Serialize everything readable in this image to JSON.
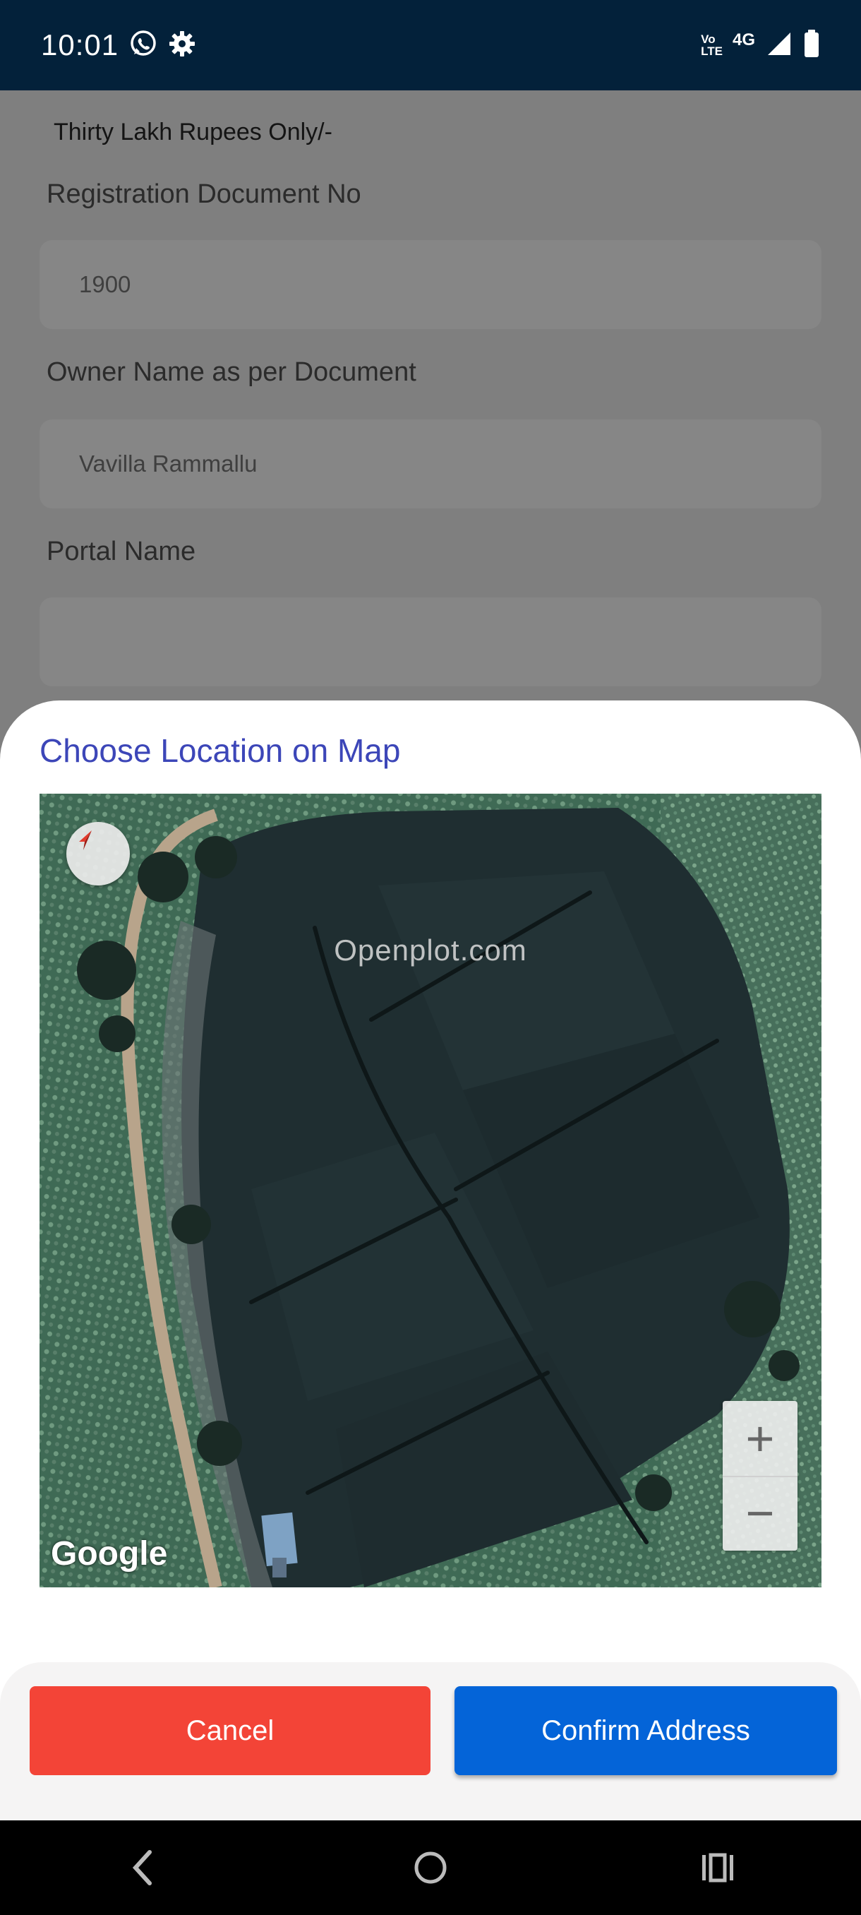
{
  "status_bar": {
    "time": "10:01",
    "volte_line1": "Vo",
    "volte_line2": "LTE",
    "network": "4G",
    "icons": [
      "whatsapp-icon",
      "gear-icon",
      "signal-icon",
      "battery-icon"
    ]
  },
  "form": {
    "amount_words": "Thirty Lakh Rupees Only/-",
    "fields": [
      {
        "label": "Registration Document No",
        "value": "1900"
      },
      {
        "label": "Owner Name as per Document",
        "value": "Vavilla Rammallu"
      },
      {
        "label": "Portal Name",
        "value": ""
      }
    ]
  },
  "sheet": {
    "title": "Choose Location on Map",
    "map": {
      "watermark": "Openplot.com",
      "attribution": "Google",
      "zoom_in_label": "+",
      "zoom_out_label": "−"
    }
  },
  "actions": {
    "cancel_label": "Cancel",
    "confirm_label": "Confirm Address"
  },
  "colors": {
    "status_bar": "#03213a",
    "title": "#3c46b8",
    "cancel": "#f34437",
    "confirm": "#0464d8"
  }
}
